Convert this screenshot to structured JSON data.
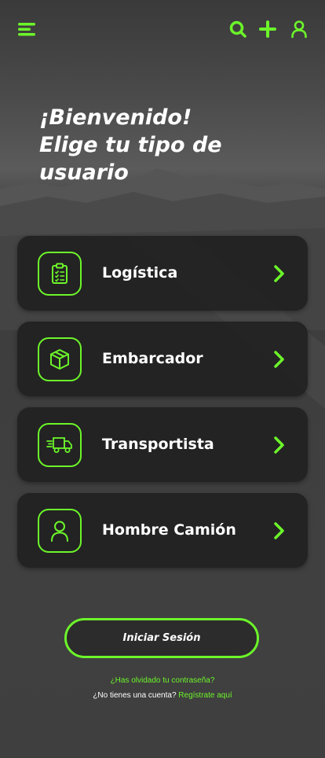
{
  "colors": {
    "accent": "#6cf52a",
    "card_bg": "#222222",
    "background": "#3e3e3e"
  },
  "topbar": {
    "menu_icon": "hamburger-menu-icon",
    "search_icon": "search-icon",
    "add_icon": "plus-icon",
    "profile_icon": "user-icon"
  },
  "heading": {
    "line1": "¡Bienvenido!",
    "line2": "Elige tu tipo de",
    "line3": "usuario"
  },
  "user_types": [
    {
      "label": "Logística",
      "icon": "clipboard-checklist-icon"
    },
    {
      "label": "Embarcador",
      "icon": "package-box-icon"
    },
    {
      "label": "Transportista",
      "icon": "delivery-truck-icon"
    },
    {
      "label": "Hombre Camión",
      "icon": "person-icon"
    }
  ],
  "login_button": "Iniciar Sesión",
  "forgot_password": "¿Has olvidado tu contraseña?",
  "register": {
    "prompt": "¿No tienes una cuenta?",
    "link": "Regístrate aquí"
  }
}
